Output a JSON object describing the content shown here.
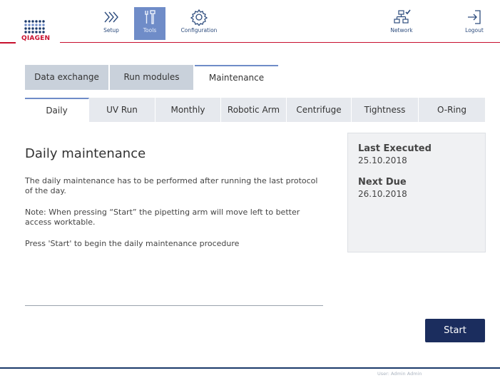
{
  "brand": {
    "name": "QIAGEN",
    "primary": "#1b2d5e",
    "accent": "#6f8cc8",
    "red": "#c8102e"
  },
  "nav": {
    "setup": {
      "label": "Setup",
      "icon": "chevrons-right-icon"
    },
    "tools": {
      "label": "Tools",
      "icon": "tools-icon",
      "active": true
    },
    "configuration": {
      "label": "Configuration",
      "icon": "gear-icon"
    },
    "network": {
      "label": "Network",
      "icon": "network-icon"
    },
    "logout": {
      "label": "Logout",
      "icon": "logout-icon"
    }
  },
  "top_tabs": [
    {
      "label": "Data exchange"
    },
    {
      "label": "Run modules"
    },
    {
      "label": "Maintenance",
      "active": true
    }
  ],
  "sub_tabs": [
    {
      "label": "Daily",
      "active": true
    },
    {
      "label": "UV Run"
    },
    {
      "label": "Monthly"
    },
    {
      "label": "Robotic Arm"
    },
    {
      "label": "Centrifuge"
    },
    {
      "label": "Tightness"
    },
    {
      "label": "O-Ring"
    }
  ],
  "main": {
    "title": "Daily maintenance",
    "para1": "The daily maintenance has to be performed after running the last protocol of the day.",
    "para2": "Note: When pressing “Start” the pipetting arm will move left to better access worktable.",
    "para3": "Press 'Start' to begin the daily maintenance procedure"
  },
  "info": {
    "last_executed_label": "Last Executed",
    "last_executed_value": "25.10.2018",
    "next_due_label": "Next Due",
    "next_due_value": "26.10.2018"
  },
  "actions": {
    "start_label": "Start"
  },
  "footer": {
    "user": "User: Admin Admin"
  }
}
